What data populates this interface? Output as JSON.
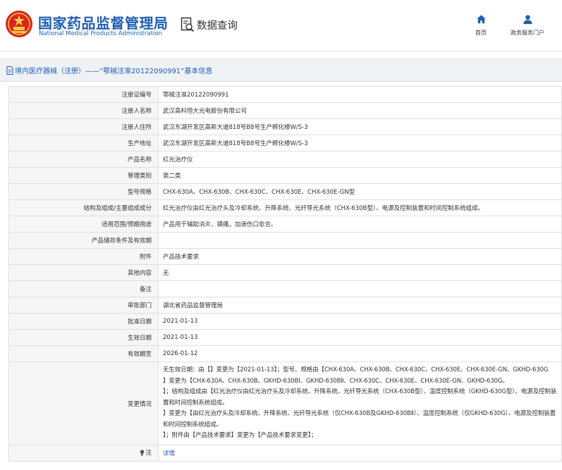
{
  "header": {
    "title_cn": "国家药品监督管理局",
    "title_en": "National Medical Products Administration",
    "search_label": "数据查询",
    "nav_home": "首页",
    "nav_gov": "政务服务门户",
    "brand_color": "#1f5fb3",
    "emblem_color": "#d8261c"
  },
  "breadcrumb": {
    "text": "境内医疗器械（注册）——“鄂械注准20122090991”基本信息"
  },
  "table": {
    "rows": [
      {
        "label": "注册证编号",
        "value": "鄂械注准20122090991"
      },
      {
        "label": "注册人名称",
        "value": "武汉高科恒大光电股份有限公司"
      },
      {
        "label": "注册人住所",
        "value": "武汉东湖开发区高新大道818号B8号生产孵化楼W/S-3"
      },
      {
        "label": "生产地址",
        "value": "武汉东湖开发区高新大道818号B8号生产孵化楼W/S-3"
      },
      {
        "label": "产品名称",
        "value": "红光治疗仪"
      },
      {
        "label": "管理类别",
        "value": "第二类"
      },
      {
        "label": "型号规格",
        "value": "CHX-630A、CHX-630B、CHX-630C、CHX-630E、CHX-630E-GN型"
      },
      {
        "label": "结构及组成/主要组成成分",
        "value": "红光治疗仪由红光治疗头及冷却系统、升降系统、光纤导光系统（CHX-630B型）、电源及控制装置和时间控制系统组成。"
      },
      {
        "label": "适用范围/预期用途",
        "value": "产品用于辅助消炎、镇痛，加速伤口愈合。"
      },
      {
        "label": "产品储存条件及有效期",
        "value": ""
      },
      {
        "label": "附件",
        "value": "产品技术要求"
      },
      {
        "label": "其他内容",
        "value": "无"
      },
      {
        "label": "备注",
        "value": ""
      },
      {
        "label": "审批部门",
        "value": "湖北省药品监督管理局"
      },
      {
        "label": "批准日期",
        "value": "2021-01-13"
      },
      {
        "label": "生效日期",
        "value": "2021-01-13"
      },
      {
        "label": "有效期至",
        "value": "2026-01-12"
      }
    ],
    "change_label": "变更情况",
    "change_lines": [
      "无生效日期：由【】变更为【2021-01-13】；型号、规格由【CHX-630A、CHX-630B、CHX-630C、CHX-630E、CHX-630E-GN、GKHD-630G",
      "】变更为【CHX-630A、CHX-630B、GKHD-630BI、GKHD-630BⅡ、CHX-630C、CHX-630E、CHX-630E-GN、GKHD-630G。",
      "】；结构及组成由【红光治疗仪由红光治疗头及冷却系统、升降系统、光纤导光系统（CHX-630B型）、温度控制系统（GKHD-630G型）、电源及控制装置和时间控制系统组成。",
      "】变更为【由红光治疗头及冷却系统、升降系统、光纤导光系统（仅CHX-630B及GKHD-630BⅡ）、温度控制系统（仅GKHD-630G）、电源及控制装置和时间控制系统组成。",
      "】；附件由【产品技术要求】变更为【产品技术要求变更】；"
    ],
    "note_label": "注",
    "detail_link": "详情"
  }
}
